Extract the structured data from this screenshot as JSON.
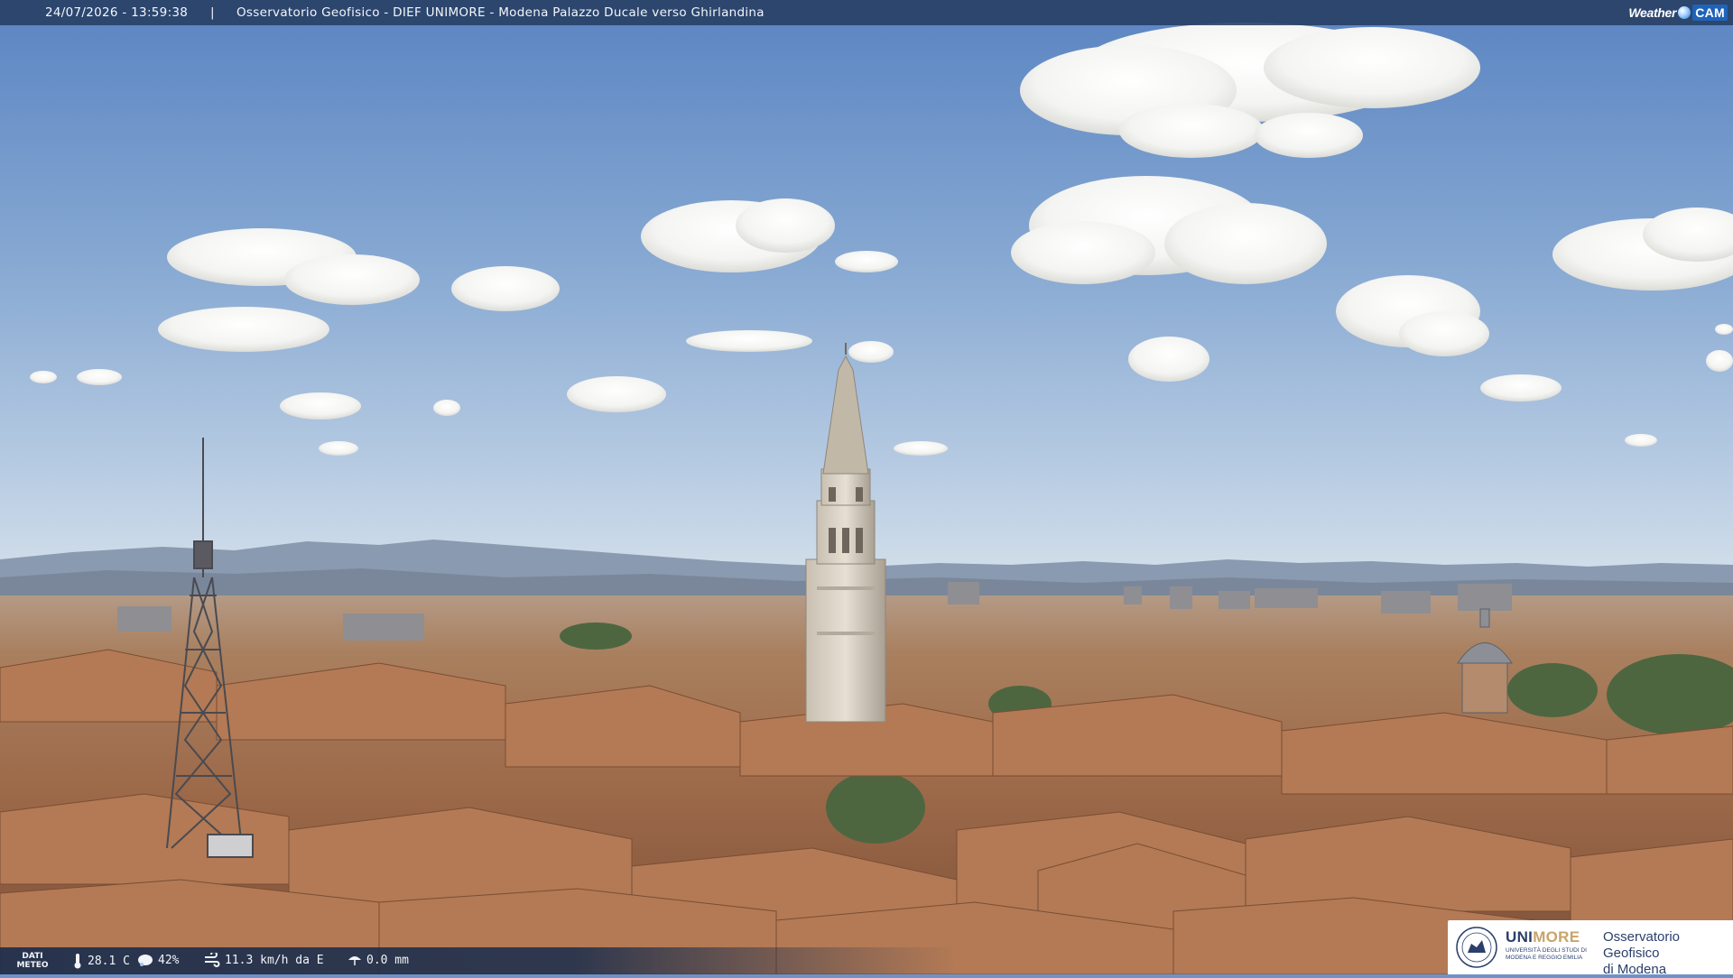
{
  "header": {
    "timestamp": "24/07/2026 - 13:59:38",
    "separator": "|",
    "camera_title": "Osservatorio Geofisico - DIEF UNIMORE - Modena Palazzo Ducale verso Ghirlandina",
    "brand_text": "Weather",
    "brand_cam": "CAM"
  },
  "weather": {
    "label": "DATI METEO",
    "temperature": "28.1 C",
    "humidity": "42%",
    "wind": "11.3 km/h da E",
    "rain": "0.0 mm"
  },
  "logo": {
    "university_prefix": "UNI",
    "university_suffix": "MORE",
    "university_sub": "UNIVERSITÀ DEGLI STUDI DI MODENA E REGGIO EMILIA",
    "observatory_line1": "Osservatorio Geofisico",
    "observatory_line2": "di Modena"
  },
  "colors": {
    "sky_top": "#5f88c4",
    "sky_horizon": "#c9d8e8",
    "mountains": "#7d8fa6",
    "roofs": "#a86e4c",
    "tower": "#d9d1c4",
    "bar": "#263e62"
  }
}
